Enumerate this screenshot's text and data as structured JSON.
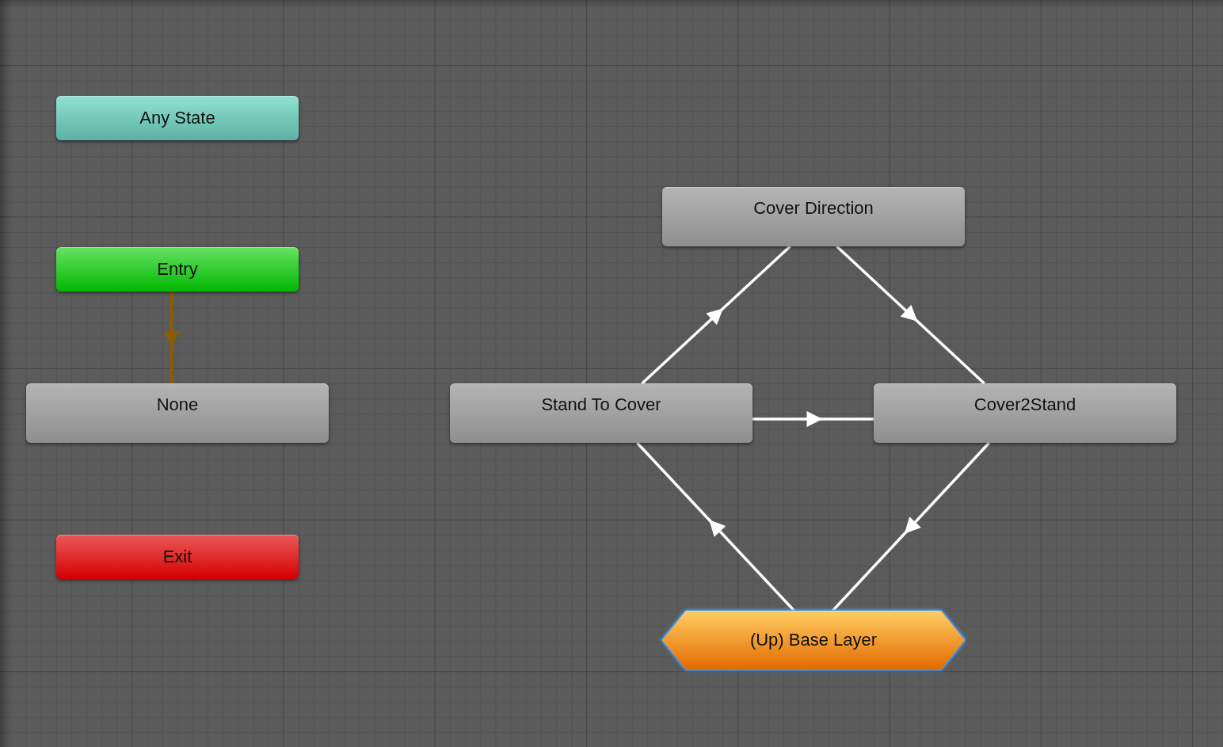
{
  "graph": {
    "nodes": [
      {
        "kind": "any_state",
        "label": "Any State",
        "selected": false
      },
      {
        "kind": "entry",
        "label": "Entry",
        "selected": false
      },
      {
        "kind": "state",
        "label": "None",
        "selected": false
      },
      {
        "kind": "exit",
        "label": "Exit",
        "selected": false
      },
      {
        "kind": "state",
        "label": "Cover Direction",
        "selected": false
      },
      {
        "kind": "state",
        "label": "Stand To Cover",
        "selected": false
      },
      {
        "kind": "state",
        "label": "Cover2Stand",
        "selected": false
      },
      {
        "kind": "parent_layer",
        "label": "(Up) Base Layer",
        "selected": true
      }
    ],
    "transitions": [
      {
        "kind": "default"
      },
      {
        "kind": "normal"
      },
      {
        "kind": "normal"
      },
      {
        "kind": "normal"
      },
      {
        "kind": "normal"
      },
      {
        "kind": "normal"
      }
    ]
  }
}
